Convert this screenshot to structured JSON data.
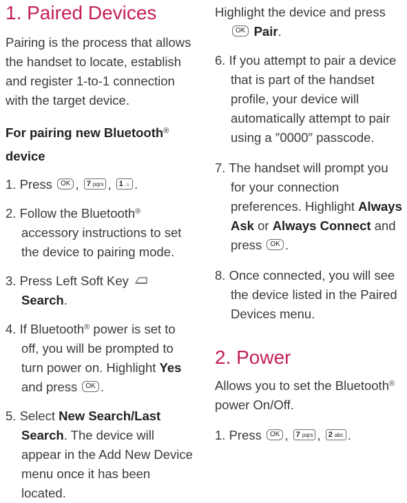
{
  "left": {
    "heading": "1. Paired Devices",
    "intro": "Pairing is the process that allows the handset to locate, establish and register 1-to-1 connection with the target device.",
    "subheading": {
      "pre": "For pairing new Bluetooth",
      "sup": "®",
      "post": "device"
    },
    "step1": {
      "num": "1.",
      "text": "Press",
      "sep": ",",
      "end": "."
    },
    "step2": {
      "num": "2.",
      "pre": "Follow the Bluetooth",
      "sup": "®",
      "post": "accessory instructions to set the device to pairing mode."
    },
    "step3": {
      "num": "3.",
      "pre": "Press Left Soft Key",
      "bold": "Search",
      "end": "."
    },
    "step4": {
      "num": "4.",
      "pre": "If Bluetooth",
      "sup": "®",
      "mid": "power is set to off, you will be prompted to turn power on. Highlight",
      "bold": "Yes",
      "post": "and press",
      "end": "."
    },
    "step5": {
      "num": "5.",
      "pre": "Select",
      "bold1": "New Search",
      "slash": "/",
      "bold2": "Last Search",
      "post": ". The device will appear in the Add New Device menu once it has been located."
    }
  },
  "right": {
    "cont": {
      "pre": "Highlight the device and press",
      "bold": "Pair",
      "end": "."
    },
    "step6": {
      "num": "6.",
      "text": "If you attempt to pair a device that is part of the handset profile, your device will automatically attempt to pair using a ″0000″ passcode."
    },
    "step7": {
      "num": "7.",
      "pre": "The handset will prompt you for your connection preferences. Highlight",
      "bold1": "Always Ask",
      "or": "or",
      "bold2": "Always Connect",
      "post": "and press",
      "end": "."
    },
    "step8": {
      "num": "8.",
      "text": "Once connected, you will see the device listed in the Paired Devices menu."
    },
    "heading2": "2. Power",
    "intro2": {
      "pre": "Allows you to set the Bluetooth",
      "sup": "®",
      "post": "power On/Off."
    },
    "step_p1": {
      "num": "1.",
      "text": "Press",
      "sep": ",",
      "end": "."
    }
  },
  "keys": {
    "ok": "OK",
    "seven": {
      "digit": "7",
      "letters": "pqrs"
    },
    "one": {
      "digit": "1",
      "letters": "♨"
    },
    "two": {
      "digit": "2",
      "letters": "abc"
    }
  },
  "icons": {
    "left_soft_key": "left-soft-key-icon"
  },
  "colors": {
    "heading": "#c41e5a",
    "text": "#3a3a3a"
  }
}
